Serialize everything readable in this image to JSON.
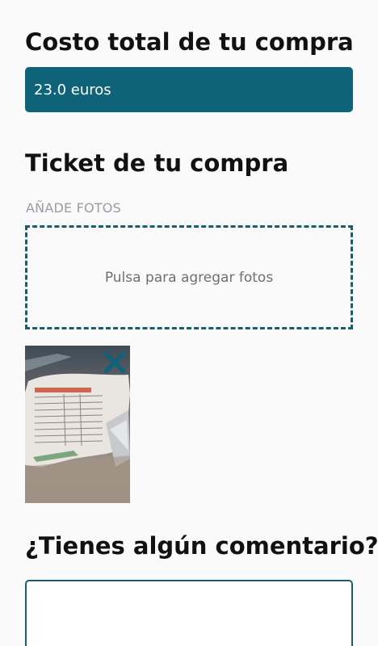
{
  "total": {
    "heading": "Costo total de tu compra",
    "value": "23.0 euros"
  },
  "ticket": {
    "heading": "Ticket de tu compra",
    "add_photos_label": "AÑADE FOTOS",
    "dropzone_text": "Pulsa para agregar fotos",
    "photos": [
      {
        "description_icon": "receipt-photo",
        "remove_icon": "close-icon"
      }
    ]
  },
  "comment": {
    "heading": "¿Tienes algún comentario?",
    "value": ""
  },
  "colors": {
    "accent": "#0e6379",
    "border": "#195d6e",
    "background": "#fafafa",
    "label": "#9a9aa6"
  }
}
